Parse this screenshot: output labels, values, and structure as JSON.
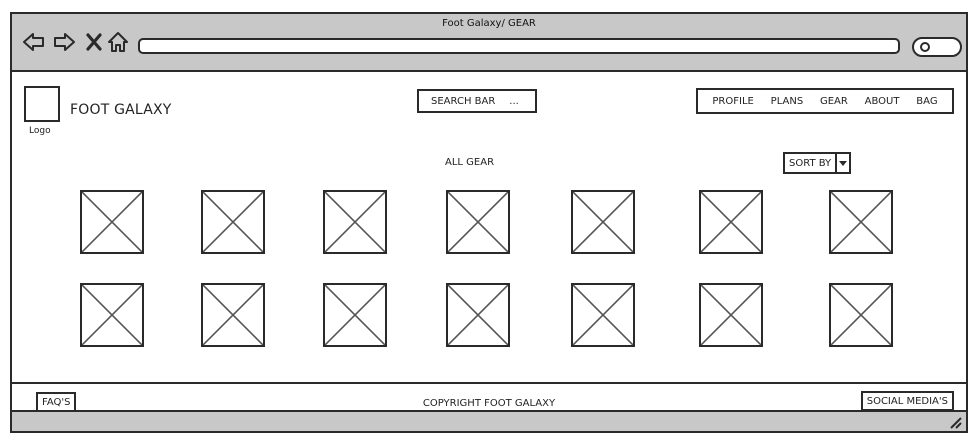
{
  "window": {
    "title": "Foot Galaxy/ GEAR",
    "nav_icons": [
      "back-arrow-icon",
      "forward-arrow-icon",
      "close-icon",
      "home-icon"
    ],
    "address_value": "",
    "search_icon": "magnifier-icon"
  },
  "header": {
    "logo_caption": "Logo",
    "brand": "FOOT GALAXY",
    "search_label": "SEARCH BAR",
    "search_ellipsis": "...",
    "nav": [
      "PROFILE",
      "PLANS",
      "GEAR",
      "ABOUT",
      "BAG"
    ]
  },
  "main": {
    "section_title": "ALL GEAR",
    "sort_label": "SORT BY",
    "product_rows": 2,
    "products_per_row": 7
  },
  "footer": {
    "faq": "FAQ'S",
    "copyright": "COPYRIGHT FOOT GALAXY",
    "social": "SOCIAL MEDIA'S"
  },
  "colors": {
    "chrome": "#c8c8c8",
    "stroke": "#2a2a2a",
    "background": "#ffffff"
  }
}
